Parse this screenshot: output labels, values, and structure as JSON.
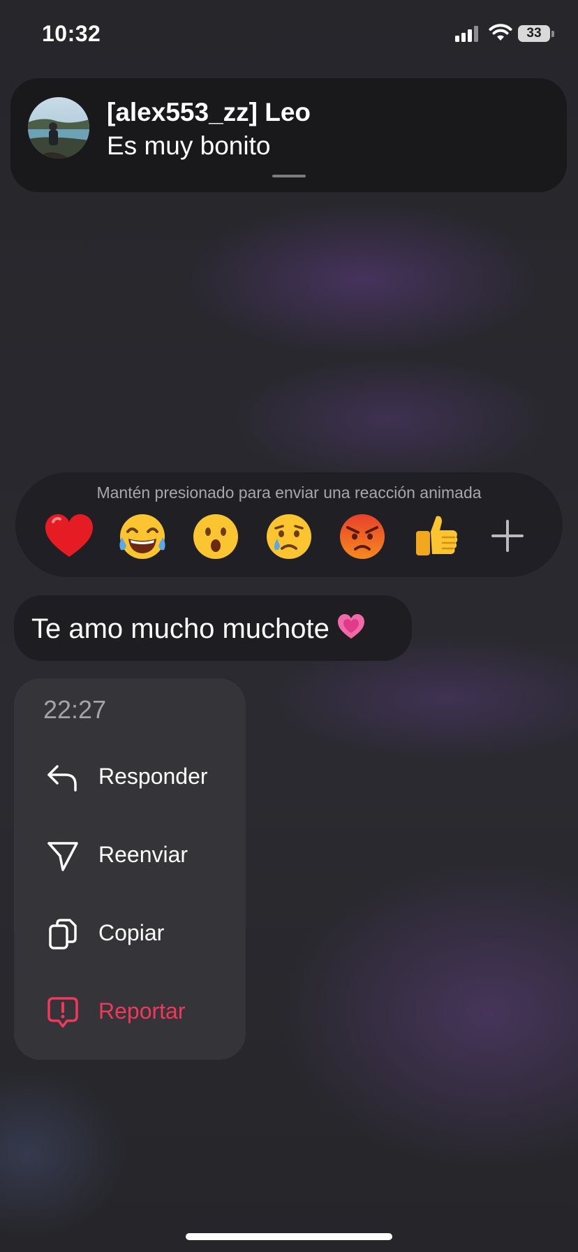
{
  "status_bar": {
    "time": "10:32",
    "battery": "33"
  },
  "notification": {
    "sender": "[alex553_zz] Leo",
    "message": "Es muy bonito"
  },
  "reactions": {
    "hint": "Mantén presionado para enviar una reacción animada",
    "items": [
      {
        "icon": "red-heart-emoji"
      },
      {
        "icon": "tears-of-joy-emoji"
      },
      {
        "icon": "surprised-face-emoji"
      },
      {
        "icon": "crying-face-emoji"
      },
      {
        "icon": "angry-face-emoji"
      },
      {
        "icon": "thumbs-up-emoji"
      },
      {
        "icon": "plus-icon"
      }
    ]
  },
  "message": {
    "text": "Te amo mucho muchote",
    "emoji": "growing-heart-emoji"
  },
  "context_menu": {
    "time": "22:27",
    "items": [
      {
        "label": "Responder",
        "icon": "reply-icon"
      },
      {
        "label": "Reenviar",
        "icon": "send-icon"
      },
      {
        "label": "Copiar",
        "icon": "copy-icon"
      },
      {
        "label": "Reportar",
        "icon": "report-icon",
        "color": "#f0395a"
      }
    ]
  },
  "colors": {
    "danger": "#f0395a",
    "menu_background": "#353539",
    "bubble_background": "#1d1d22"
  }
}
